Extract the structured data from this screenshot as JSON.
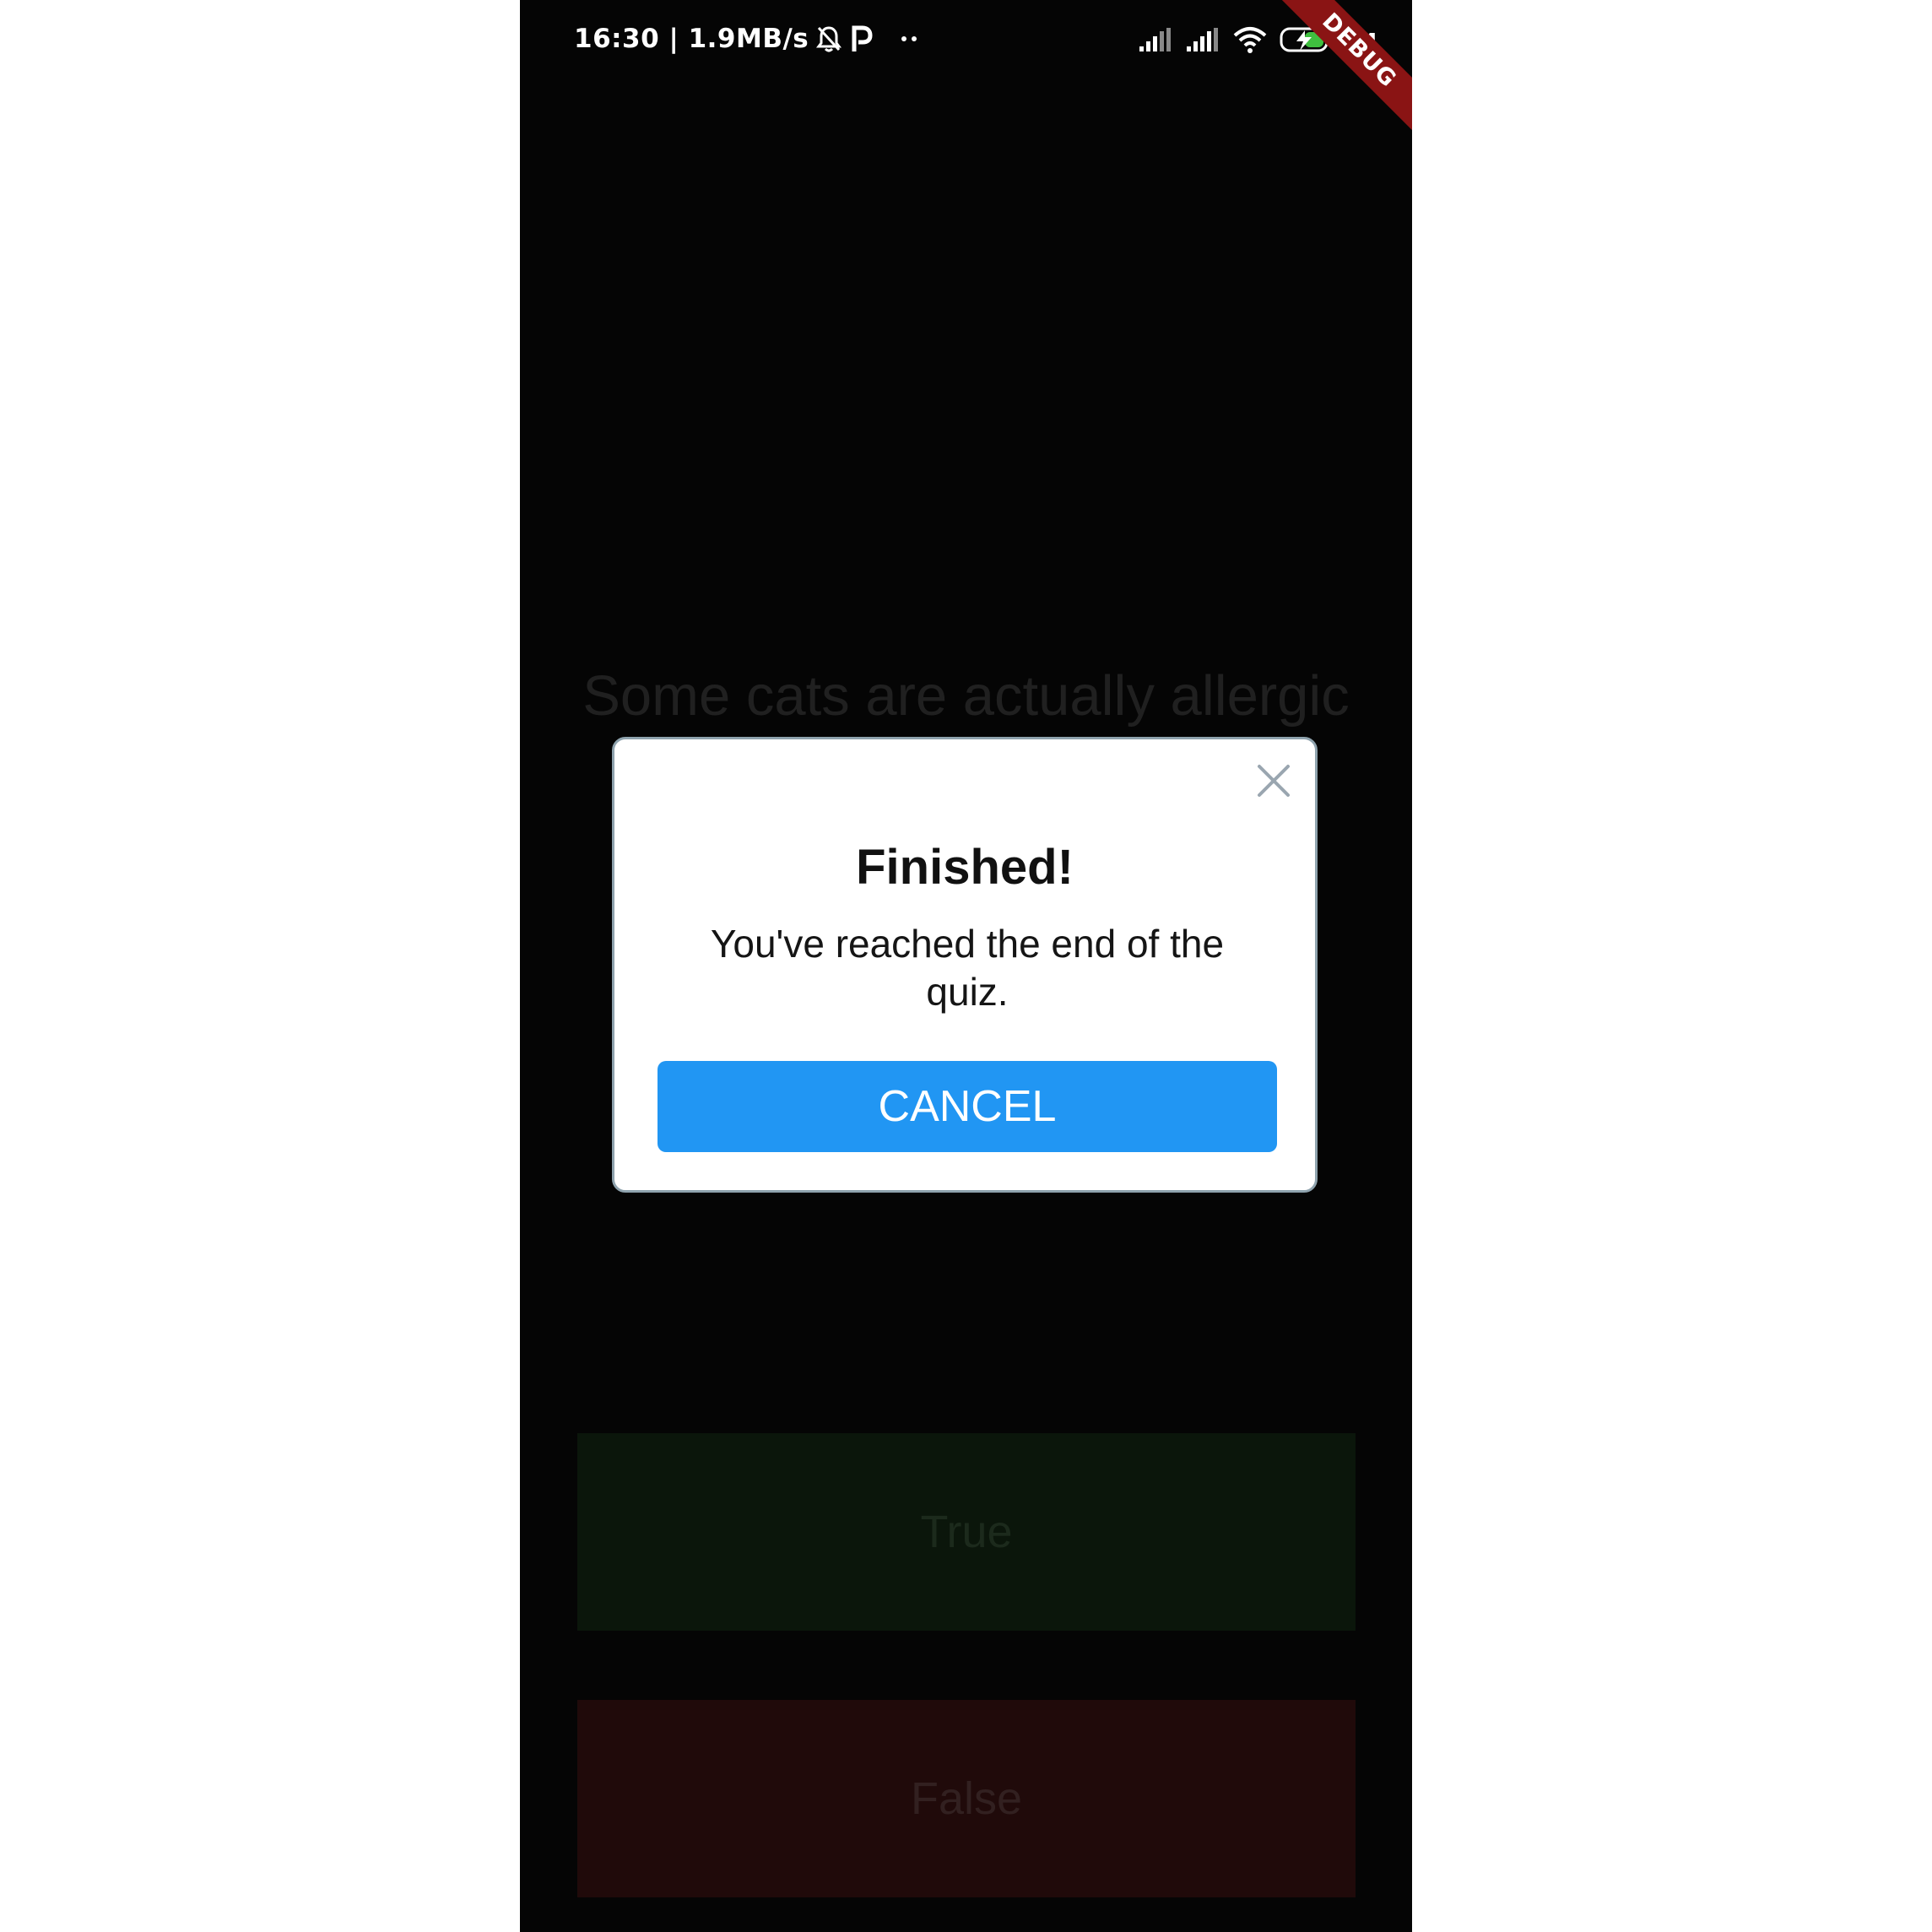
{
  "status_bar": {
    "time_speed": "16:30 | 1.9MB/s",
    "battery_percent": "84",
    "icons": [
      "mute-bell-icon",
      "p-app-icon",
      "more-dots-icon",
      "signal-icon",
      "signal-icon",
      "wifi-icon",
      "battery-charging-icon"
    ]
  },
  "debug_banner": "DEBUG",
  "quiz": {
    "question": "Some cats are actually allergic",
    "true_label": "True",
    "false_label": "False"
  },
  "dialog": {
    "title": "Finished!",
    "message": "You've reached the end of the quiz.",
    "cancel_label": "CANCEL",
    "close_icon": "close-icon"
  },
  "colors": {
    "primary": "#2196f3",
    "true_button_dimmed": "#0b160b",
    "false_button_dimmed": "#200a0a",
    "debug_ribbon": "#8a1414"
  }
}
